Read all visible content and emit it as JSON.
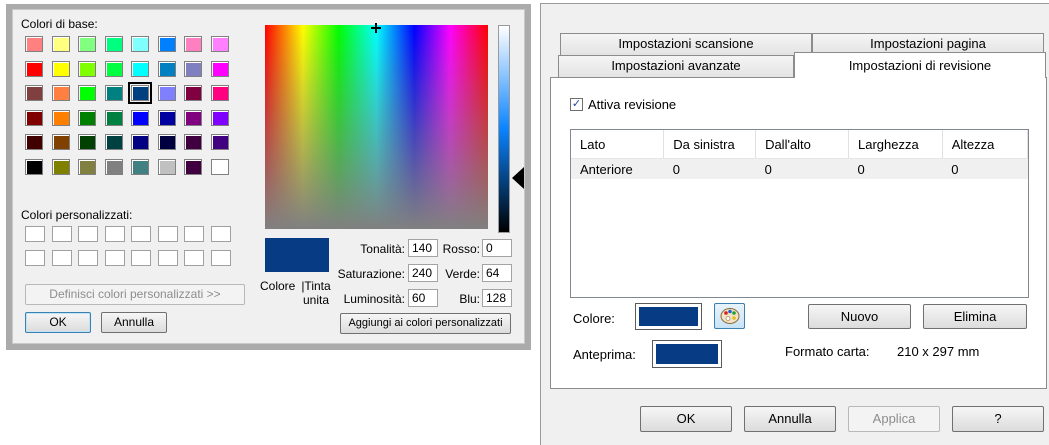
{
  "color_dialog": {
    "basic_label": "Colori di base:",
    "custom_label": "Colori personalizzati:",
    "define_button": "Definisci colori personalizzati >>",
    "ok_button": "OK",
    "cancel_button": "Annulla",
    "basic_colors": [
      [
        "#ff8080",
        "#ffff80",
        "#80ff80",
        "#00ff80",
        "#80ffff",
        "#0080ff",
        "#ff80c0",
        "#ff80ff"
      ],
      [
        "#ff0000",
        "#ffff00",
        "#80ff00",
        "#00ff40",
        "#00ffff",
        "#0080c0",
        "#8080c0",
        "#ff00ff"
      ],
      [
        "#804040",
        "#ff8040",
        "#00ff00",
        "#008080",
        "#004080",
        "#8080ff",
        "#800040",
        "#ff0080"
      ],
      [
        "#800000",
        "#ff8000",
        "#008000",
        "#008040",
        "#0000ff",
        "#0000a0",
        "#800080",
        "#8000ff"
      ],
      [
        "#400000",
        "#804000",
        "#004000",
        "#004040",
        "#000080",
        "#000040",
        "#400040",
        "#400080"
      ],
      [
        "#000000",
        "#808000",
        "#808040",
        "#808080",
        "#408080",
        "#c0c0c0",
        "#400040",
        "#ffffff"
      ]
    ],
    "selected_basic": {
      "row": 2,
      "col": 4
    },
    "solid_color_label": "Colore",
    "solid_color_label2": "|Tinta unita",
    "current_color": "#073c84",
    "hue_label": "Tonalità:",
    "hue_value": "140",
    "saturation_label": "Saturazione:",
    "saturation_value": "240",
    "luminosity_label": "Luminosità:",
    "luminosity_value": "60",
    "red_label": "Rosso:",
    "red_value": "0",
    "green_label": "Verde:",
    "green_value": "64",
    "blue_label": "Blu:",
    "blue_value": "128",
    "add_button": "Aggiungi ai colori personalizzati"
  },
  "props_dialog": {
    "tabs_back": [
      "Impostazioni scansione",
      "Impostazioni pagina"
    ],
    "tabs_front": [
      "Impostazioni avanzate",
      "Impostazioni di revisione"
    ],
    "active_tab": "Impostazioni di revisione",
    "enable_checkbox_label": "Attiva revisione",
    "enable_checked": true,
    "table": {
      "columns": [
        "Lato",
        "Da sinistra",
        "Dall'alto",
        "Larghezza",
        "Altezza"
      ],
      "rows": [
        [
          "Anteriore",
          "0",
          "0",
          "0",
          "0"
        ]
      ]
    },
    "color_label": "Colore:",
    "color_value": "#073c84",
    "new_button": "Nuovo",
    "delete_button": "Elimina",
    "preview_label": "Anteprima:",
    "paper_format_label": "Formato carta:",
    "paper_format_value": "210 x 297 mm",
    "footer": {
      "ok": "OK",
      "cancel": "Annulla",
      "apply": "Applica",
      "help": "?"
    }
  }
}
